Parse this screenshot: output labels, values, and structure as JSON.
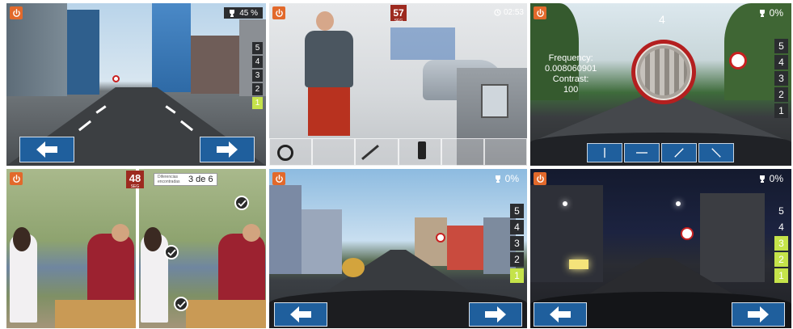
{
  "panel1": {
    "score": "45 %",
    "levels": [
      "5",
      "4",
      "3",
      "2",
      "1"
    ],
    "active_level": "1"
  },
  "panel2": {
    "timer_value": "57",
    "timer_unit": "SEG",
    "clock": "02:53"
  },
  "panel3": {
    "score": "0%",
    "top_number": "4",
    "frequency_label": "Frequency:",
    "frequency_value": "0.008060901",
    "contrast_label": "Contrast:",
    "contrast_value": "100",
    "levels": [
      "5",
      "4",
      "3",
      "2",
      "1"
    ]
  },
  "panel4": {
    "timer_value": "48",
    "timer_unit": "SEG",
    "differences_label": "Diferencias encontradas",
    "differences_count": "3 de 6"
  },
  "panel5": {
    "score": "0%",
    "levels": [
      "5",
      "4",
      "3",
      "2",
      "1"
    ],
    "active_level": "1"
  },
  "panel6": {
    "score": "0%",
    "levels": [
      "5",
      "4",
      "3",
      "2",
      "1"
    ],
    "active_levels": [
      "3",
      "2",
      "1"
    ]
  },
  "colors": {
    "power_orange": "#e2692b",
    "arrow_blue": "#1f5f9d",
    "level_green": "#c5e34a",
    "timer_red": "#9d2a1f",
    "sign_red": "#c82020"
  },
  "icons": [
    "power-icon",
    "trophy-icon",
    "arrow-left-icon",
    "arrow-right-icon",
    "clock-icon",
    "check-icon"
  ]
}
